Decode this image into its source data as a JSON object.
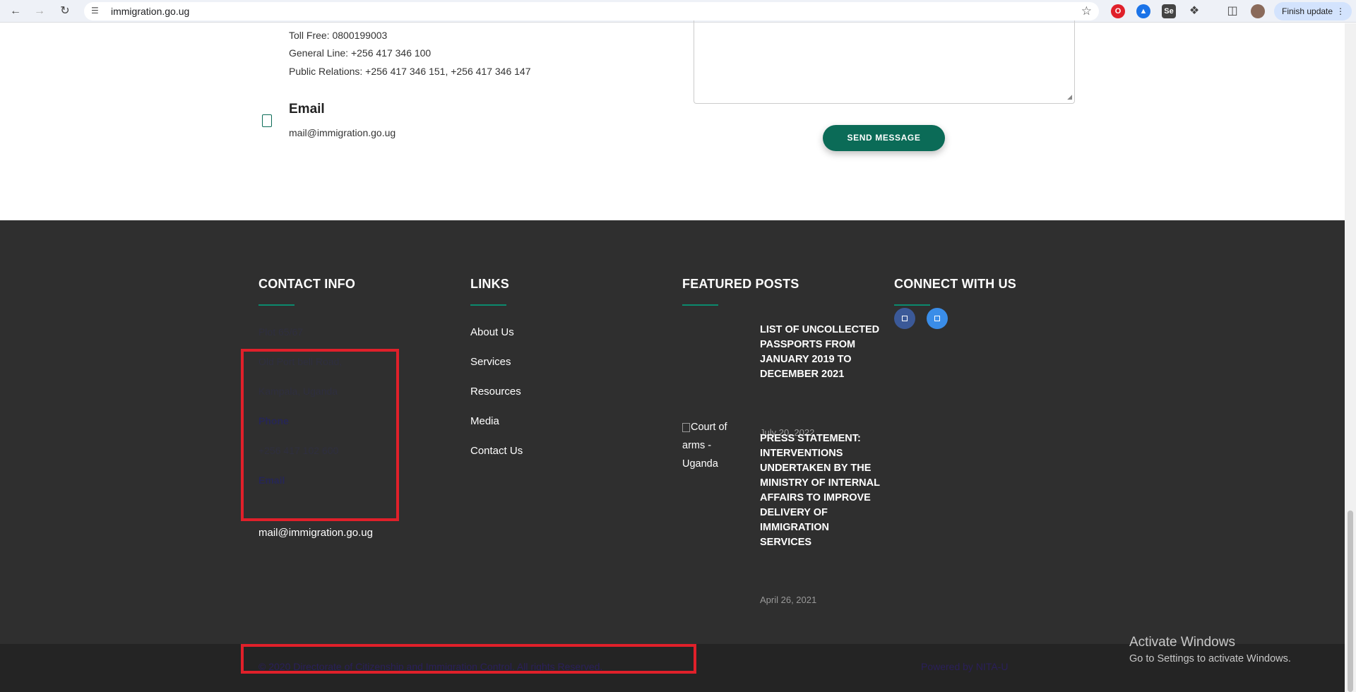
{
  "browser": {
    "url": "immigration.go.ug",
    "back_icon": "arrow-left-icon",
    "forward_icon": "arrow-right-icon",
    "reload_icon": "reload-icon",
    "finish_update_label": "Finish update"
  },
  "contact_section": {
    "toll_free": "Toll Free: 0800199003",
    "general_line": "General Line: +256 417 346 100",
    "public_relations": "Public Relations: +256 417 346 151, +256 417 346 147",
    "email_heading": "Email",
    "email_value": "mail@immigration.go.ug",
    "send_button": "SEND MESSAGE"
  },
  "footer": {
    "contact_info": {
      "heading": "CONTACT INFO",
      "address_line_1": "Plot 65/67",
      "address_line_2": "Old Port bell Road,",
      "address_line_3": "Kampala, Uganda",
      "phone_label": "Phone",
      "phone_value": "+256 417 102 600",
      "email_label": "Email",
      "email_value": "mail@immigration.go.ug"
    },
    "links": {
      "heading": "LINKS",
      "items": [
        "About Us",
        "Services",
        "Resources",
        "Media",
        "Contact Us"
      ]
    },
    "featured_posts": {
      "heading": "FEATURED POSTS",
      "posts": [
        {
          "title": "LIST OF UNCOLLECTED PASSPORTS FROM JANUARY 2019 TO DECEMBER 2021",
          "date": "July 20, 2022"
        },
        {
          "title": "PRESS STATEMENT: INTERVENTIONS UNDERTAKEN BY THE MINISTRY OF INTERNAL AFFAIRS TO IMPROVE DELIVERY OF IMMIGRATION SERVICES",
          "date": "April 26, 2021",
          "image_alt": "Court of arms - Uganda"
        }
      ]
    },
    "connect": {
      "heading": "CONNECT WITH US",
      "facebook_color": "#3b5998",
      "twitter_color": "#3a8de8"
    }
  },
  "bottom_bar": {
    "copyright": "© 2020 Directorate of Citizenship and Immigration Control. All rights Reserved.",
    "powered_by": "Powered by NITA-U"
  },
  "windows_watermark": {
    "title": "Activate Windows",
    "subtitle": "Go to Settings to activate Windows."
  },
  "colors": {
    "accent": "#0b6b57",
    "footer_bg": "#2f2f2f",
    "highlight": "#e0202a"
  }
}
